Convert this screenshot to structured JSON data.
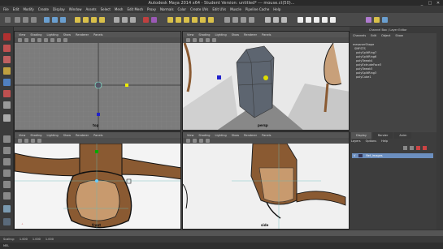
{
  "window": {
    "title": "Autodesk Maya 2014 x64 - Student Version: untitled*   ---   mouse.ct(50)...",
    "controls": [
      "_",
      "□",
      "✕"
    ]
  },
  "menubar": [
    "File",
    "Edit",
    "Modify",
    "Create",
    "Display",
    "Window",
    "Assets",
    "Select",
    "Mesh",
    "Edit Mesh",
    "Proxy",
    "Normals",
    "Color",
    "Create UVs",
    "Edit UVs",
    "Muscle",
    "Pipeline Cache",
    "Help"
  ],
  "viewports": {
    "menu": [
      "View",
      "Shading",
      "Lighting",
      "Show",
      "Renderer",
      "Panels"
    ],
    "top": {
      "label": "top"
    },
    "persp": {
      "label": "persp"
    },
    "front": {
      "label": "front"
    },
    "side": {
      "label": "side"
    }
  },
  "channel_box": {
    "title": "Channel Box / Layer Editor",
    "menu": [
      "Channels",
      "Edit",
      "Object",
      "Show"
    ],
    "items": [
      "mesanerShape",
      "SMFSTS",
      "polySplitRing7",
      "polySplitRing6",
      "polyTweak4",
      "polyExtrudeFace3",
      "polyTweak3",
      "polySplitRing3",
      "polyCube1"
    ]
  },
  "layers": {
    "tabs": [
      "Display",
      "Render",
      "Anim"
    ],
    "menu": [
      "Layers",
      "Options",
      "Help"
    ],
    "row": {
      "v": "V",
      "name": "Ref_images"
    }
  },
  "status": {
    "fields": [
      "Scaling:",
      "1.000",
      "1.000",
      "1.000"
    ],
    "cmd_label": "MEL"
  },
  "colors": {
    "brown": "#8a5a32",
    "tan": "#c8a07a",
    "layer_blue": "#6c8fbf"
  }
}
